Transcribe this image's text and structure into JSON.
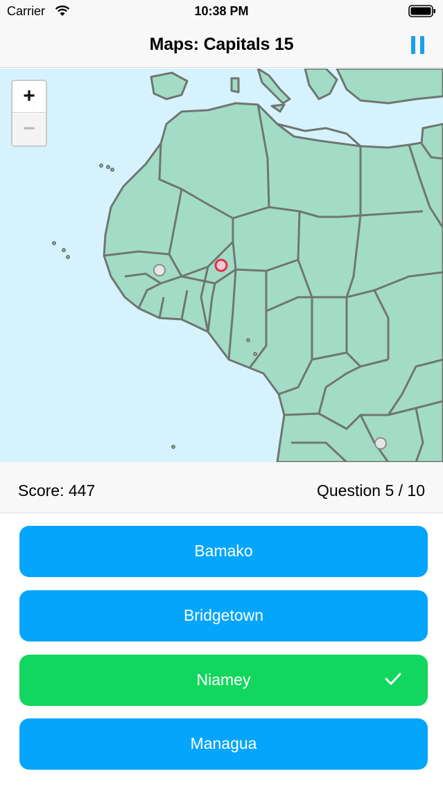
{
  "status_bar": {
    "carrier": "Carrier",
    "time": "10:38 PM",
    "icons": [
      "wifi-icon",
      "battery-icon"
    ]
  },
  "nav": {
    "title": "Maps: Capitals 15",
    "pause_icon": "pause-icon",
    "accent_color": "#1aa0ee"
  },
  "map": {
    "zoom_in_label": "+",
    "zoom_out_label": "−",
    "water_color": "#d6f3fd",
    "land_color": "#a3dcc6",
    "border_color": "#6f7671",
    "highlight_marker_color": "#e0304a"
  },
  "score": {
    "score_label": "Score: 447",
    "question_label": "Question 5 / 10"
  },
  "answers": [
    {
      "label": "Bamako",
      "state": "default"
    },
    {
      "label": "Bridgetown",
      "state": "default"
    },
    {
      "label": "Niamey",
      "state": "correct",
      "icon": "checkmark-icon"
    },
    {
      "label": "Managua",
      "state": "default"
    }
  ],
  "colors": {
    "answer_default": "#05a5fc",
    "answer_correct": "#12d75f"
  }
}
